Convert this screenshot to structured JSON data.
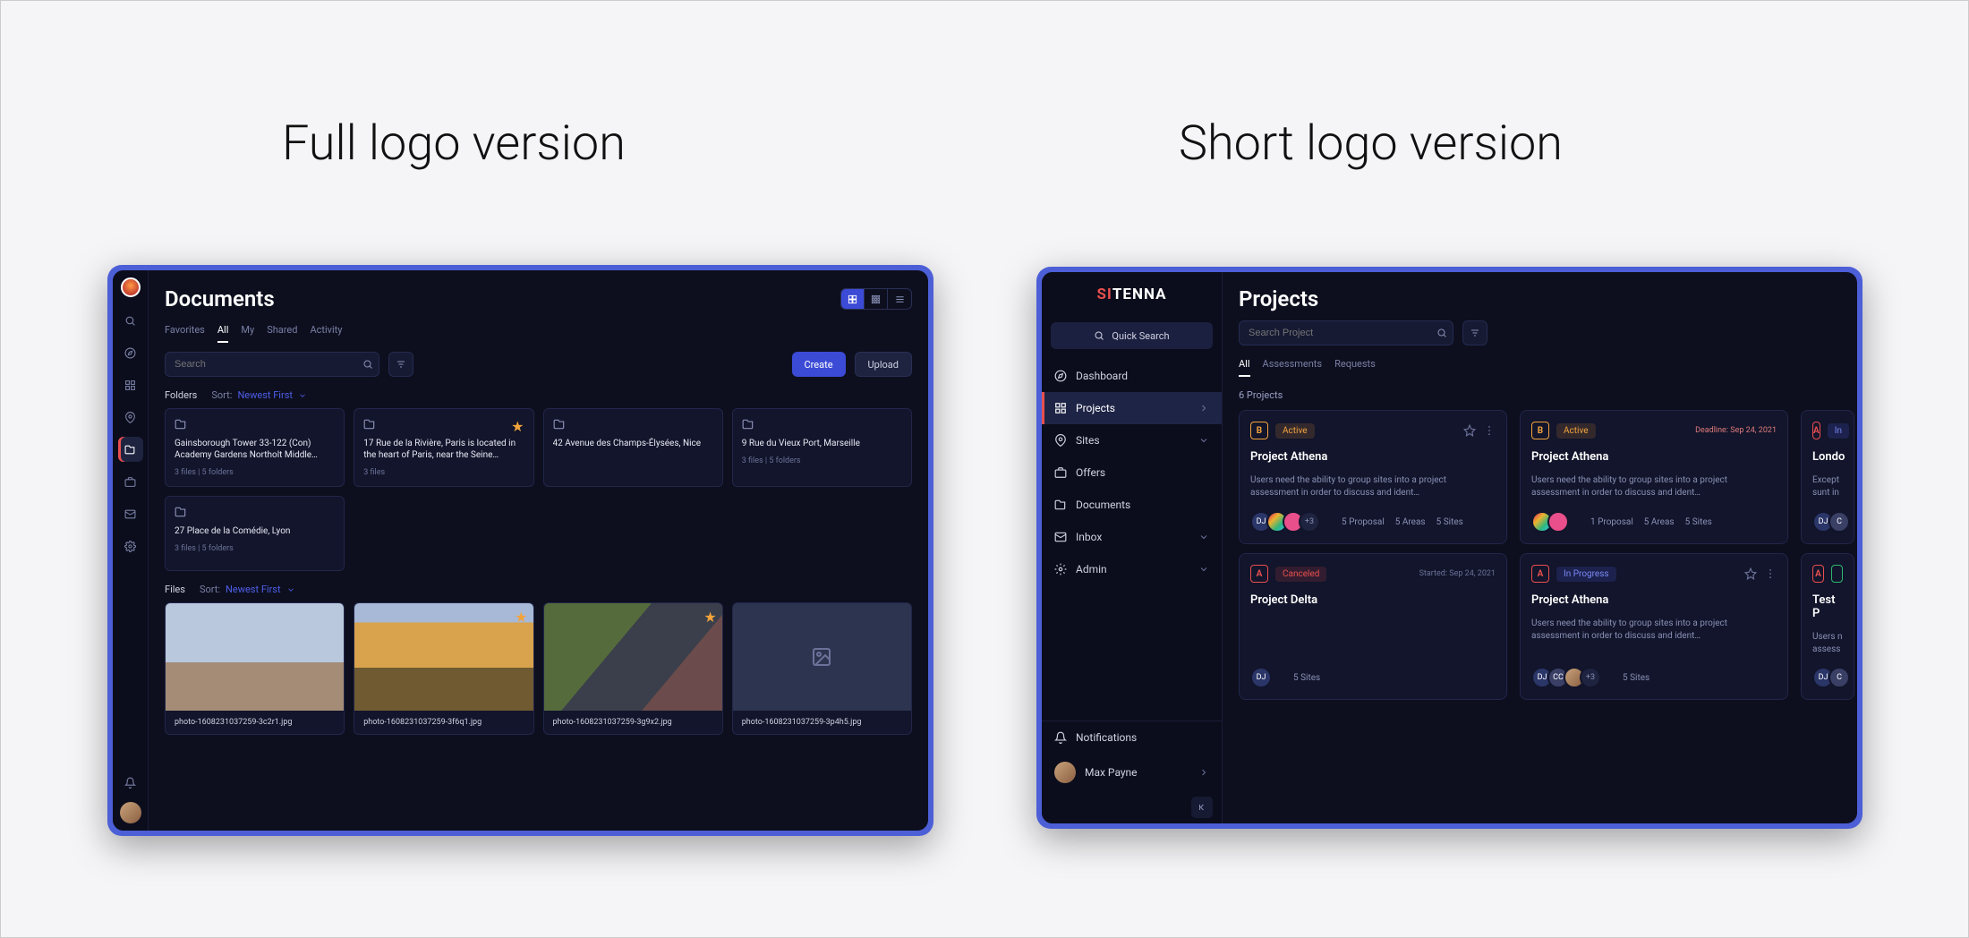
{
  "headings": {
    "left": "Full logo version",
    "right": "Short logo version"
  },
  "leftApp": {
    "title": "Documents",
    "tabs": [
      "Favorites",
      "All",
      "My",
      "Shared",
      "Activity"
    ],
    "activeTab": "All",
    "searchPlaceholder": "Search",
    "buttons": {
      "create": "Create",
      "upload": "Upload"
    },
    "foldersLabel": "Folders",
    "filesLabel": "Files",
    "sortLabel": "Sort:",
    "sortValue": "Newest First",
    "folders": [
      {
        "title": "Gainsborough Tower 33-122 (Con) Academy Gardens Northolt Middle…",
        "meta": "3 files | 5 folders",
        "star": false
      },
      {
        "title": "17 Rue de la Rivière, Paris is located in the heart of Paris, near the Seine…",
        "meta": "3 files",
        "star": true
      },
      {
        "title": "42 Avenue des Champs-Élysées, Nice",
        "meta": "",
        "star": false
      },
      {
        "title": "9 Rue du Vieux Port, Marseille",
        "meta": "3 files | 5 folders",
        "star": false
      },
      {
        "title": "27 Place de la Comédie, Lyon",
        "meta": "3 files | 5 folders",
        "star": false
      }
    ],
    "files": [
      {
        "name": "photo-1608231037259-3c2r1.jpg",
        "star": false,
        "thumb": "thumb1"
      },
      {
        "name": "photo-1608231037259-3f6q1.jpg",
        "star": true,
        "thumb": "thumb2"
      },
      {
        "name": "photo-1608231037259-3g9x2.jpg",
        "star": true,
        "thumb": "thumb3"
      },
      {
        "name": "photo-1608231037259-3p4h5.jpg",
        "star": false,
        "thumb": "placeholder"
      }
    ]
  },
  "rightApp": {
    "brand": {
      "part1": "SI",
      "part2": "TENNA"
    },
    "quickSearch": "Quick Search",
    "nav": {
      "dashboard": "Dashboard",
      "projects": "Projects",
      "sites": "Sites",
      "offers": "Offers",
      "documents": "Documents",
      "inbox": "Inbox",
      "admin": "Admin",
      "notifications": "Notifications"
    },
    "user": "Max Payne",
    "title": "Projects",
    "searchPlaceholder": "Search Project",
    "tabs": [
      "All",
      "Assessments",
      "Requests"
    ],
    "countText": "6 Projects",
    "cards": {
      "c1": {
        "badge": "Active",
        "title": "Project Athena",
        "desc": "Users need the ability to group sites into a project assessment in order to discuss and ident…",
        "more": "+3",
        "stats": {
          "p": "5 Proposal",
          "a": "5 Areas",
          "s": "5 Sites"
        }
      },
      "c2": {
        "badge": "Active",
        "deadline": "Deadline: Sep 24, 2021",
        "title": "Project Athena",
        "desc": "Users need the ability to group sites into a project assessment in order to discuss and ident…",
        "stats": {
          "p": "1 Proposal",
          "a": "5 Areas",
          "s": "5 Sites"
        }
      },
      "c3": {
        "badge": "In",
        "title": "Londo",
        "desc": "Except sunt in",
        "stats": {}
      },
      "c4": {
        "badge": "Canceled",
        "started": "Started: Sep 24, 2021",
        "title": "Project Delta",
        "stats": {
          "s": "5 Sites"
        }
      },
      "c5": {
        "badge": "In Progress",
        "title": "Project Athena",
        "desc": "Users need the ability to group sites into a project assessment in order to discuss and ident…",
        "more": "+3",
        "stats": {
          "s": "5 Sites"
        }
      },
      "c6": {
        "title": "Test P",
        "desc": "Users n assess",
        "more": ""
      }
    }
  }
}
